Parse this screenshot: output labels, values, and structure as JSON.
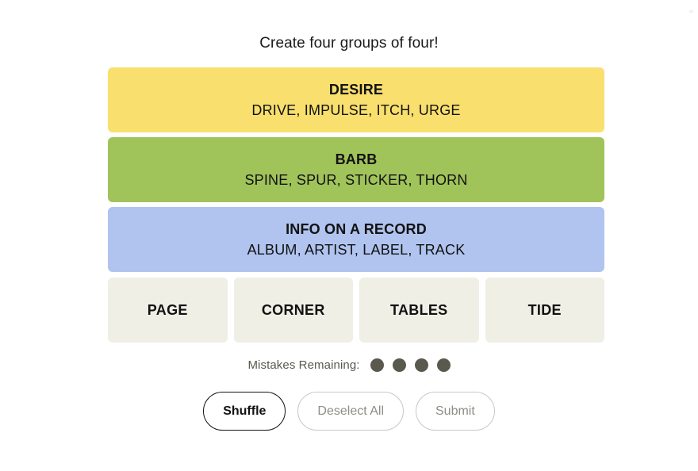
{
  "header": {
    "instruction": "Create four groups of four!"
  },
  "board": {
    "solved_groups": [
      {
        "category": "DESIRE",
        "members": "DRIVE, IMPULSE, ITCH, URGE",
        "color": "#f9df6d",
        "difficulty": "yellow"
      },
      {
        "category": "BARB",
        "members": "SPINE, SPUR, STICKER, THORN",
        "color": "#a0c35a",
        "difficulty": "green"
      },
      {
        "category": "INFO ON A RECORD",
        "members": "ALBUM, ARTIST, LABEL, TRACK",
        "color": "#b0c4ef",
        "difficulty": "blue"
      }
    ],
    "remaining_tiles": [
      {
        "label": "PAGE"
      },
      {
        "label": "CORNER"
      },
      {
        "label": "TABLES"
      },
      {
        "label": "TIDE"
      }
    ],
    "tile_color": "#efefe6"
  },
  "mistakes": {
    "label": "Mistakes Remaining:",
    "remaining": 4,
    "dots": [
      1,
      2,
      3,
      4
    ],
    "dot_color": "#5a594e"
  },
  "controls": {
    "shuffle_label": "Shuffle",
    "deselect_label": "Deselect All",
    "submit_label": "Submit"
  }
}
